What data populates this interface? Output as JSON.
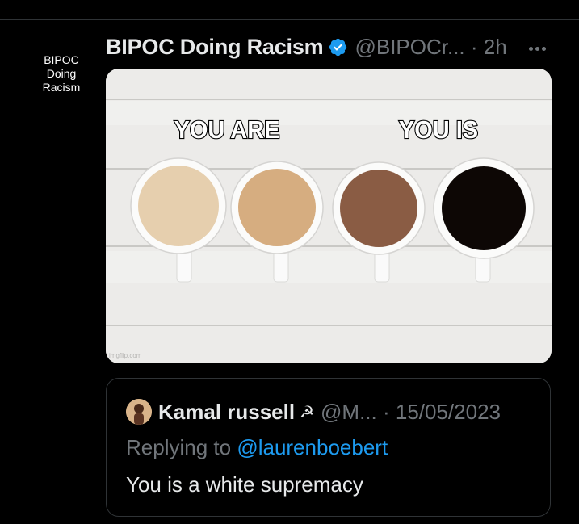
{
  "tweet": {
    "avatar_text": "BIPOC\nDoing\nRacism",
    "display_name": "BIPOC Doing Racism",
    "verified_icon": "verified-badge-icon",
    "handle_time": "@BIPOCr... · 2h",
    "more_icon": "more-options-icon",
    "media": {
      "caption_left": "YOU ARE",
      "caption_right": "YOU IS",
      "watermark": "imgflip.com"
    }
  },
  "quote": {
    "display_name": "Kamal russell",
    "name_emoji": "☭",
    "handle_time": "@M... · 15/05/2023",
    "replying_prefix": "Replying to",
    "replying_to": "@laurenboebert",
    "text": "You is a white supremacy"
  },
  "colors": {
    "background": "#000000",
    "accent": "#1d9bf0",
    "muted": "#71767b",
    "text": "#e7e9ea"
  }
}
